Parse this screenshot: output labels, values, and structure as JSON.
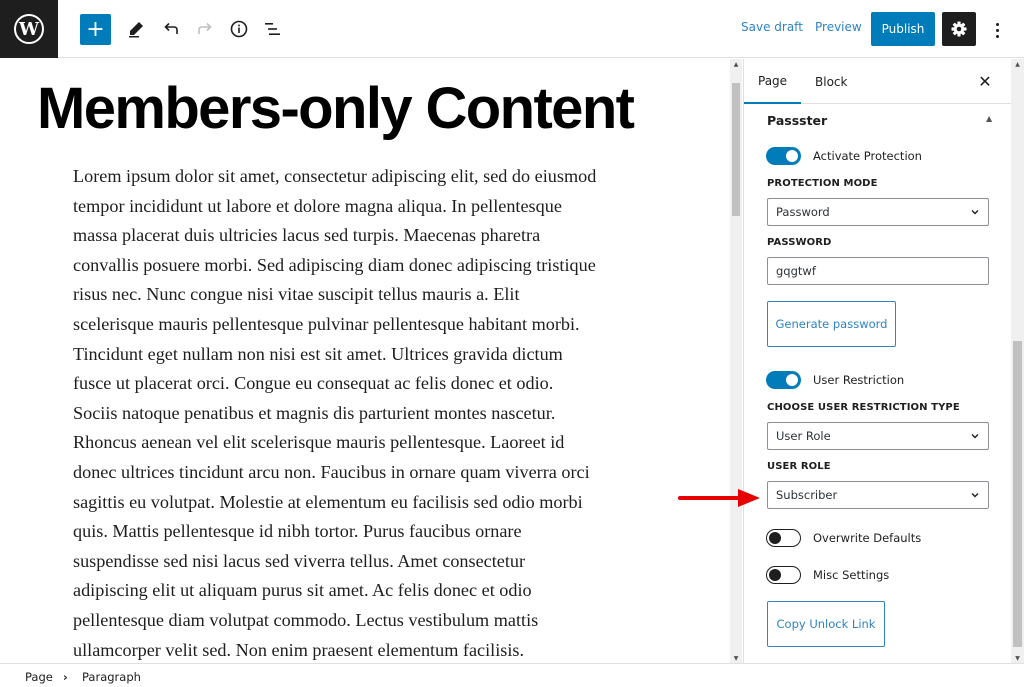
{
  "toolbar": {
    "logo_icon": "wordpress-logo-icon",
    "add_block_label": "+",
    "tools": [
      "pencil-icon",
      "undo-icon",
      "redo-icon",
      "info-icon",
      "list-view-icon"
    ],
    "save_draft_label": "Save draft",
    "preview_label": "Preview",
    "publish_label": "Publish",
    "settings_icon": "gear-icon",
    "more_icon": "more-vertical-icon"
  },
  "editor": {
    "title": "Members-only Content",
    "paragraph_lines": [
      "Lorem ipsum dolor sit amet, consectetur adipiscing elit, sed do eiusmod",
      "tempor incididunt ut labore et dolore magna aliqua. In pellentesque",
      "massa placerat duis ultricies lacus sed turpis. Maecenas pharetra",
      "convallis posuere morbi. Sed adipiscing diam donec adipiscing tristique",
      "risus nec. Nunc congue nisi vitae suscipit tellus mauris a. Elit",
      "scelerisque mauris pellentesque pulvinar pellentesque habitant morbi.",
      "Tincidunt eget nullam non nisi est sit amet. Ultrices gravida dictum",
      "fusce ut placerat orci. Congue eu consequat ac felis donec et odio.",
      "Sociis natoque penatibus et magnis dis parturient montes nascetur.",
      "Rhoncus aenean vel elit scelerisque mauris pellentesque. Laoreet id",
      "donec ultrices tincidunt arcu non. Faucibus in ornare quam viverra orci",
      "sagittis eu volutpat. Molestie at elementum eu facilisis sed odio morbi",
      "quis. Mattis pellentesque id nibh tortor. Purus faucibus ornare",
      "suspendisse sed nisi lacus sed viverra tellus. Amet consectetur",
      "adipiscing elit ut aliquam purus sit amet. Ac felis donec et odio",
      "pellentesque diam volutpat commodo. Lectus vestibulum mattis",
      "ullamcorper velit sed. Non enim praesent elementum facilisis."
    ]
  },
  "sidebar": {
    "tabs": [
      {
        "label": "Page",
        "active": true
      },
      {
        "label": "Block",
        "active": false
      }
    ],
    "close_label": "✕",
    "panel": {
      "title": "Passster",
      "activate_protection": {
        "label": "Activate Protection",
        "checked": true
      },
      "protection_mode": {
        "label": "PROTECTION MODE",
        "value": "Password"
      },
      "password": {
        "label": "PASSWORD",
        "value": "gqgtwf"
      },
      "generate_password_label": "Generate password",
      "user_restriction": {
        "label": "User Restriction",
        "checked": true
      },
      "restriction_type": {
        "label": "CHOOSE USER RESTRICTION TYPE",
        "value": "User Role"
      },
      "user_role": {
        "label": "USER ROLE",
        "value": "Subscriber"
      },
      "overwrite_defaults": {
        "label": "Overwrite Defaults",
        "checked": false
      },
      "misc_settings": {
        "label": "Misc Settings",
        "checked": false
      },
      "copy_unlock_link_label": "Copy Unlock Link"
    }
  },
  "annotation": {
    "type": "red-arrow",
    "points_to": "user-role-select",
    "color": "#e60000"
  },
  "footer": {
    "breadcrumb": [
      "Page",
      "Paragraph"
    ],
    "separator": "›"
  },
  "colors": {
    "accent": "#007cba",
    "dark": "#1e1e1e",
    "link": "#2f83c2"
  }
}
